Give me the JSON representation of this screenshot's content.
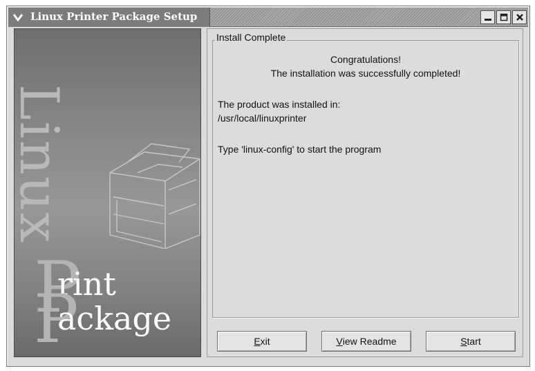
{
  "window": {
    "title": "Linux Printer Package Setup"
  },
  "side": {
    "word_linux": "Linux",
    "big_letter": "P",
    "word_print": "rint",
    "word_package": "ackage"
  },
  "group": {
    "label": "Install Complete",
    "congrats": "Congratulations!",
    "message": "The installation was successfully completed!",
    "installed_label": "The product was installed in:",
    "installed_path": "/usr/local/linuxprinter",
    "hint": "Type 'linux-config' to start the program"
  },
  "buttons": {
    "exit": {
      "mnemonic": "E",
      "rest": "xit"
    },
    "readme": {
      "mnemonic": "V",
      "rest": "iew Readme"
    },
    "start": {
      "mnemonic": "S",
      "rest": "tart"
    }
  },
  "icons": {
    "window_menu": "chevron-down-icon",
    "minimize": "minimize-icon",
    "maximize": "maximize-icon",
    "close": "close-icon"
  },
  "colors": {
    "titlebar": "#7c7c7c",
    "dialog_bg": "#dcdcdc"
  }
}
